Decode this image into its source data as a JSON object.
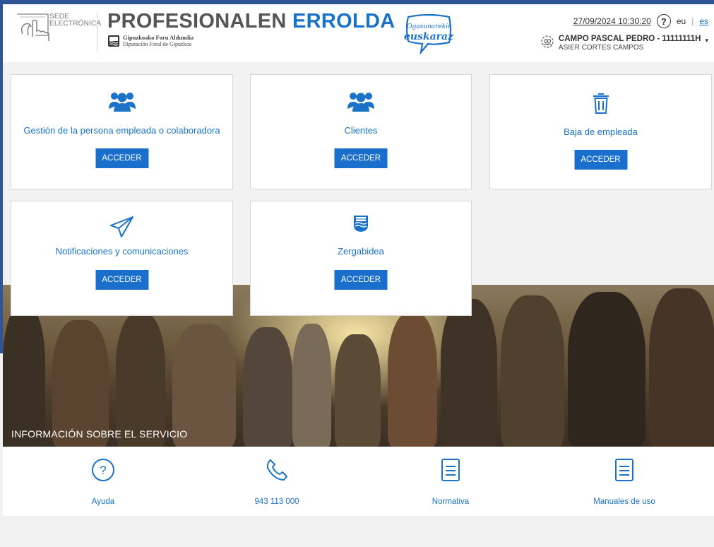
{
  "colors": {
    "accent": "#1a73c8",
    "button": "#1a6fcc",
    "header_stripe": "#2f5597"
  },
  "header": {
    "sede_label_1": "SEDE",
    "sede_label_2": "ELECTRÓNICA",
    "title_part1": "PROFESIONALEN",
    "title_part2": "ERROLDA",
    "org_line1": "Gipuzkoako Foru Aldundia",
    "org_line2": "Diputación Foral de Gipuzkoa",
    "campaign_logo_text": "Ogasunarekin euskaraz",
    "datetime": "27/09/2024  10:30:20",
    "help_symbol": "?",
    "lang_eu": "eu",
    "lang_es": "es",
    "user_name": "CAMPO PASCAL PEDRO - 11111111H",
    "user_sub": "ASIER CORTES CAMPOS",
    "user_icon": "users-swap-icon",
    "caret": "▾"
  },
  "cards": [
    {
      "label": "Gestión de la persona empleada o colaboradora",
      "button": "ACCEDER",
      "icon": "group-icon"
    },
    {
      "label": "Clientes",
      "button": "ACCEDER",
      "icon": "group-icon"
    },
    {
      "label": "Baja de empleada",
      "button": "ACCEDER",
      "icon": "trash-icon"
    },
    {
      "label": "Notificaciones y comunicaciones",
      "button": "ACCEDER",
      "icon": "paper-plane-icon"
    },
    {
      "label": "Zergabidea",
      "button": "ACCEDER",
      "icon": "coat-of-arms-icon"
    }
  ],
  "hero": {
    "caption": "INFORMACIÓN SOBRE EL SERVICIO"
  },
  "info": [
    {
      "label": "Ayuda",
      "icon": "help-circle-icon"
    },
    {
      "label": "943 113 000",
      "icon": "phone-icon"
    },
    {
      "label": "Normativa",
      "icon": "document-icon"
    },
    {
      "label": "Manuales de uso",
      "icon": "document-icon"
    }
  ]
}
